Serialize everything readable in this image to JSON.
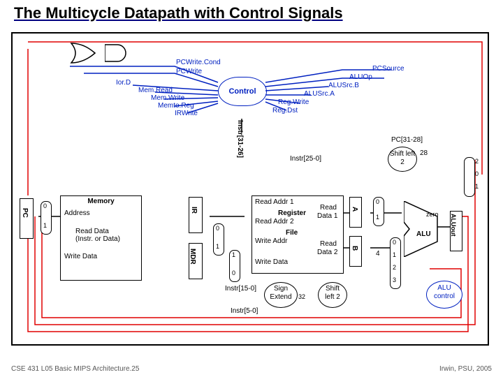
{
  "title": "The Multicycle Datapath with Control Signals",
  "footer_left": "CSE 431 L05 Basic MIPS Architecture.25",
  "footer_right": "Irwin, PSU, 2005",
  "control_label": "Control",
  "signals": {
    "pcwritecond": "PCWrite.Cond",
    "pcwrite": "PCWrite",
    "iord": "Ior.D",
    "memread": "Mem.Read",
    "memwrite": "Mem.Write",
    "memtoreg": "Memto.Reg",
    "irwrite": "IRWrite",
    "pcsource": "PCSource",
    "aluop": "ALUOp",
    "alusrcb": "ALUSrc.B",
    "alusrca": "ALUSrc.A",
    "regwrite": "Reg.Write",
    "regdst": "Reg.Dst",
    "instr31_26": "Instr[31-26]",
    "instr25_0": "Instr[25-0]",
    "instr15_0": "Instr[15-0]",
    "instr5_0": "Instr[5-0]",
    "pc31_28": "PC[31-28]"
  },
  "blocks": {
    "pc": "PC",
    "address": "Address",
    "memory": "Memory",
    "readdata": "Read Data\n(Instr. or Data)",
    "writedata": "Write Data",
    "ir": "IR",
    "mdr": "MDR",
    "readaddr1": "Read Addr 1",
    "readaddr2": "Read Addr 2",
    "register": "Register",
    "file": "File",
    "writeaddr": "Write Addr",
    "writedata2": "Write Data",
    "read": "Read",
    "data1": "Data 1",
    "data2": "Data 2",
    "a": "A",
    "b": "B",
    "signextend": "Sign\nExtend",
    "shiftleft2_a": "Shift\nleft 2",
    "shiftleft2_b": "Shift\nleft 2",
    "alu": "ALU",
    "zero": "zero",
    "aluout": "ALUout",
    "alucontrol": "ALU\ncontrol"
  },
  "numbers": {
    "n0": "0",
    "n1": "1",
    "n2": "2",
    "n3": "3",
    "n4": "4",
    "n28": "28",
    "n32": "32"
  }
}
